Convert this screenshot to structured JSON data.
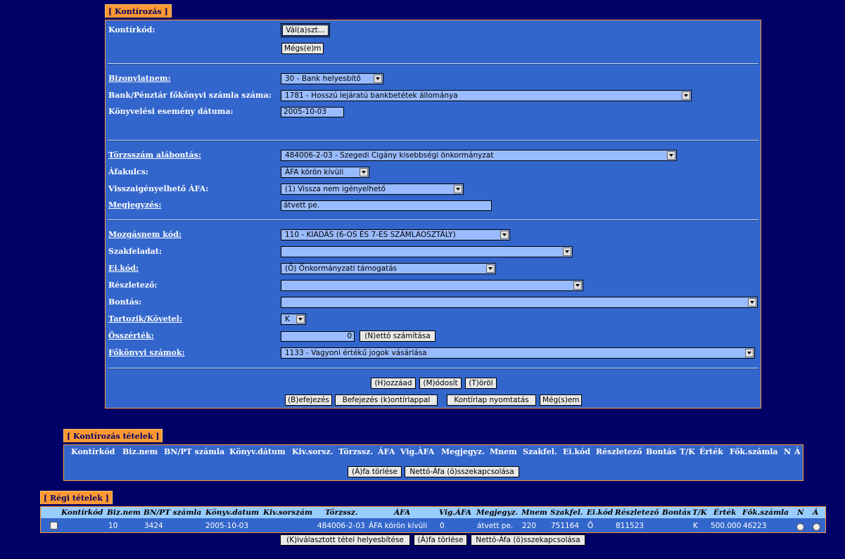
{
  "kontirozas": {
    "tab": "[ Kontírozás ]",
    "kontirkod_label": "Kontírkód:",
    "valaszt_btn": "Vál(a)szt...",
    "megsem_btn": "Mégs(e)m",
    "bizonylatnem_label": "Bizonylatnem:",
    "bizonylatnem_value": "30 - Bank helyesbítő",
    "bank_label": "Bank/Pénztár főkönyvi számla száma:",
    "bank_value": "1781 - Hosszú lejáratú bankbetétek állománya",
    "datum_label": "Könyvelési esemény dátuma:",
    "datum_value": "2005-10-03",
    "torzsszam_label": "Törzsszám alábontás:",
    "torzsszam_value": "484006-2-03 - Szegedi Cigány kisebbségi önkormányzat",
    "afakulcs_label": "Áfakulcs:",
    "afakulcs_value": "ÁFA körön kívüli",
    "vissza_label": "Visszaigényelhető ÁFA:",
    "vissza_value": "(1) Vissza nem igényelhető",
    "megjegyzes_label": "Megjegyzés:",
    "megjegyzes_value": "átvett pe.",
    "mozgasnem_label": "Mozgásnem kód:",
    "mozgasnem_value": "110 - KIADÁS (6-OS ÉS 7-ES SZÁMLAOSZTÁLY)",
    "szakfeladat_label": "Szakfeladat:",
    "szakfeladat_value": "",
    "eikod_label": "Ei.kód:",
    "eikod_value": "(Ö) Önkormányzati támogatás",
    "reszletezo_label": "Részletező:",
    "reszletezo_value": "",
    "bontas_label": "Bontás:",
    "bontas_value": "",
    "tk_label": "Tartozik/Követel:",
    "tk_value": "K",
    "osszertek_label": "Összérték:",
    "osszertek_value": "0",
    "netto_btn": "(N)ettó számítása",
    "fokonyv_label": "Főkönyvi számok:",
    "fokonyv_value": "1133 - Vagyoni értékű jogok vásárlása",
    "hozzaad_btn": "(H)ozzáad",
    "modosit_btn": "(M)ódosít",
    "torol_btn": "(T)öröl",
    "befejezes_btn": "(B)efejezés",
    "befejezes_k_btn": "Befejezés (k)ontírlappal",
    "nyomtatas_btn": "Kontírlap nyomtatás",
    "megsem2_btn": "Még(s)em"
  },
  "tetelek": {
    "tab": "[ Kontírozás tételek ]",
    "headers": [
      "Kontírkód",
      "Biz.nem",
      "BN/PT számla",
      "Könyv.dátum",
      "Kiv.sorsz.",
      "Törzssz.",
      "ÁFA",
      "Vig.ÁFA",
      "Megjegyz.",
      "Mnem",
      "Szakfel.",
      "Ei.kód",
      "Részletező",
      "Bontás",
      "T/K",
      "Érték",
      "Fők.számla",
      "N",
      "Á"
    ],
    "afa_torles_btn": "(Á)fa törlése",
    "netto_afa_btn": "Nettó-Áfa (ö)sszekapcsolása"
  },
  "regi": {
    "tab": "[ Régi tételek ]",
    "headers": [
      "Kontírkód",
      "Biz.nem",
      "BN/PT számla",
      "Könyv.datum",
      "Kiv.sorszám",
      "Törzssz.",
      "ÁFA",
      "Vig.ÁFA",
      "Megjegyz.",
      "Mnem",
      "Szakfel.",
      "Ei.kód",
      "Részletező",
      "Bontás",
      "T/K",
      "Érték",
      "Fők.számla",
      "N",
      "Á"
    ],
    "row": [
      "",
      "10",
      "3424",
      "2005-10-03",
      "",
      "484006-2-03",
      "ÁFA körön kívüli",
      "0",
      "átvett pe.",
      "220",
      "751164",
      "Ö",
      "811523",
      "",
      "K",
      "500.000",
      "46223"
    ],
    "helyesbites_btn": "(K)iválasztott tétel helyesbítése",
    "afa_torles_btn": "(Á)fa törlése",
    "netto_afa_btn": "Nettó-Áfa (ö)sszekapcsolása"
  }
}
